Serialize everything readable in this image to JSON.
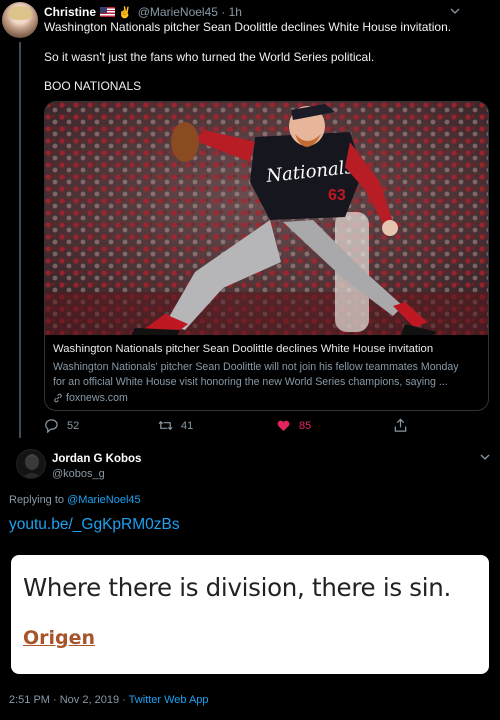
{
  "tweet1": {
    "name": "Christine",
    "handle": "@MarieNoel45",
    "separator": "·",
    "time": "1h",
    "line1": "Washington Nationals pitcher Sean Doolittle declines White House invitation.",
    "line2": "So it wasn't just the fans who turned the World Series political.",
    "line3": "BOO NATIONALS",
    "card": {
      "title": "Washington Nationals pitcher Sean Doolittle declines White House invitation",
      "desc_line1": "Washington Nationals' pitcher Sean Doolittle will not join his fellow teammates Monday",
      "desc_line2": "for an official White House visit honoring the new World Series champions, saying ...",
      "domain": "foxnews.com",
      "jersey_text": "Nationals",
      "jersey_number": "63"
    },
    "actions": {
      "replies": "52",
      "retweets": "41",
      "likes": "85"
    }
  },
  "tweet2": {
    "name": "Jordan G Kobos",
    "handle": "@kobos_g",
    "replying_prefix": "Replying to",
    "replying_to": "@MarieNoel45",
    "link": "youtu.be/_GgKpRM0zBs",
    "quote": "Where there is division, there is sin.",
    "source": "Origen",
    "timestamp": "2:51 PM · Nov 2, 2019",
    "dot": "·",
    "app": "Twitter Web App"
  },
  "colors": {
    "background": "#000000",
    "link_blue": "#1da1f2",
    "muted": "#8899a6",
    "like_red": "#e0245e",
    "origen_brown": "#a8542a"
  },
  "icons": [
    "chevron-down-icon",
    "reply-icon",
    "retweet-icon",
    "heart-icon",
    "share-icon",
    "link-icon",
    "us-flag-icon"
  ]
}
